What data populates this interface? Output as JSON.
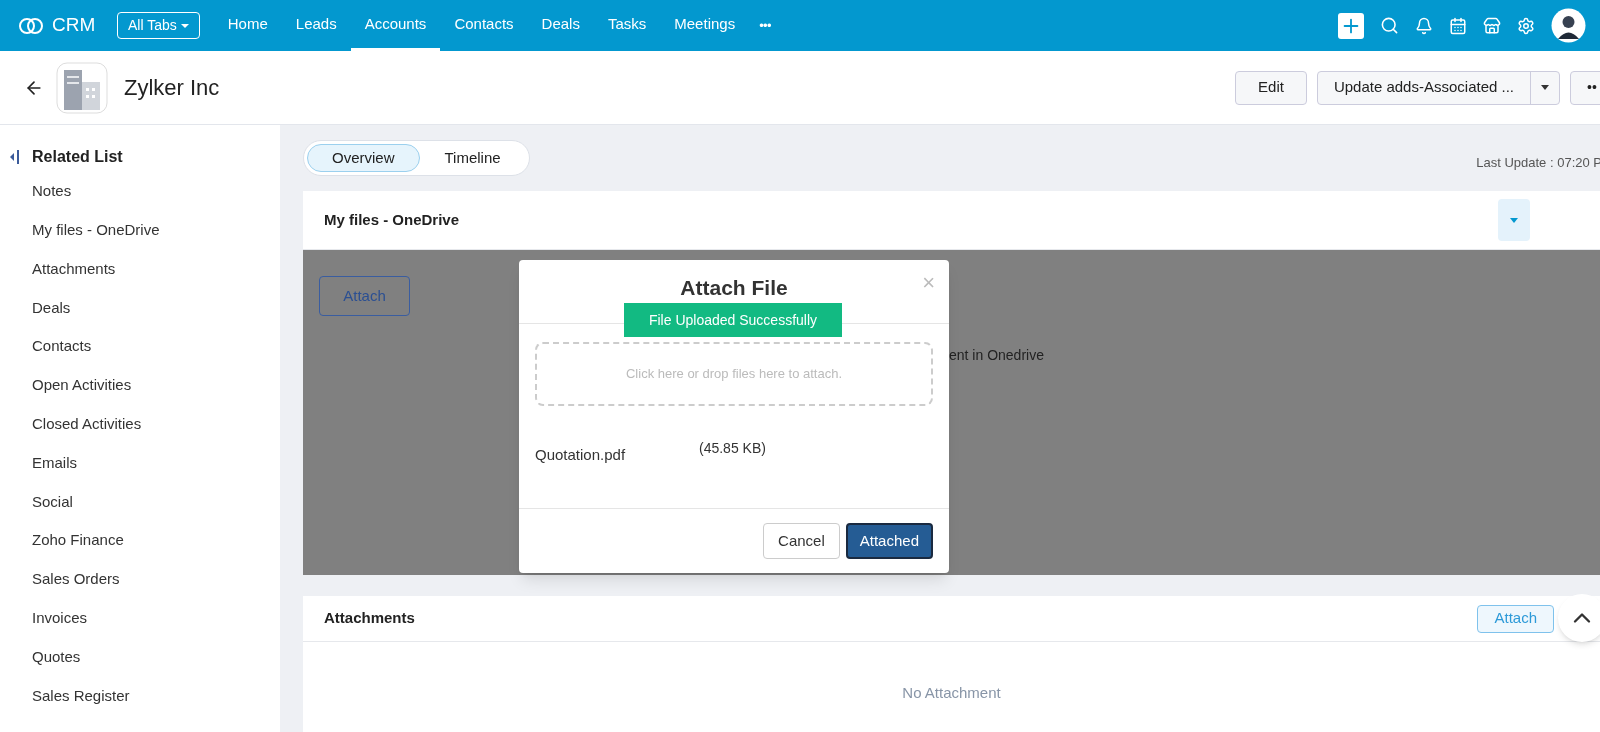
{
  "top_nav": {
    "logo": "CRM",
    "all_tabs": "All Tabs",
    "more": "•••",
    "items": [
      {
        "label": "Home",
        "selected": false
      },
      {
        "label": "Leads",
        "selected": false
      },
      {
        "label": "Accounts",
        "selected": true
      },
      {
        "label": "Contacts",
        "selected": false
      },
      {
        "label": "Deals",
        "selected": false
      },
      {
        "label": "Tasks",
        "selected": false
      },
      {
        "label": "Meetings",
        "selected": false
      }
    ]
  },
  "record": {
    "title": "Zylker Inc",
    "edit": "Edit",
    "action": "Update adds-Associated ...",
    "more": "••"
  },
  "sidebar": {
    "heading": "Related List",
    "items": [
      "Notes",
      "My files - OneDrive",
      "Attachments",
      "Deals",
      "Contacts",
      "Open Activities",
      "Closed Activities",
      "Emails",
      "Social",
      "Zoho Finance",
      "Sales Orders",
      "Invoices",
      "Quotes",
      "Sales Register"
    ]
  },
  "view_tabs": [
    {
      "label": "Overview",
      "selected": true
    },
    {
      "label": "Timeline",
      "selected": false
    }
  ],
  "last_update": "Last Update : 07:20 P",
  "onedrive_card": {
    "title": "My files - OneDrive",
    "attach": "Attach",
    "background_text": "ent in Onedrive",
    "dialog": {
      "title": "Attach File",
      "toast": "File Uploaded Successfully",
      "close": "×",
      "dropzone": "Click here or drop files here to attach.",
      "file": {
        "name": "Quotation.pdf",
        "size": "(45.85 KB)"
      },
      "cancel": "Cancel",
      "confirm": "Attached"
    }
  },
  "attachments_card": {
    "title": "Attachments",
    "attach": "Attach",
    "empty": "No Attachment"
  }
}
